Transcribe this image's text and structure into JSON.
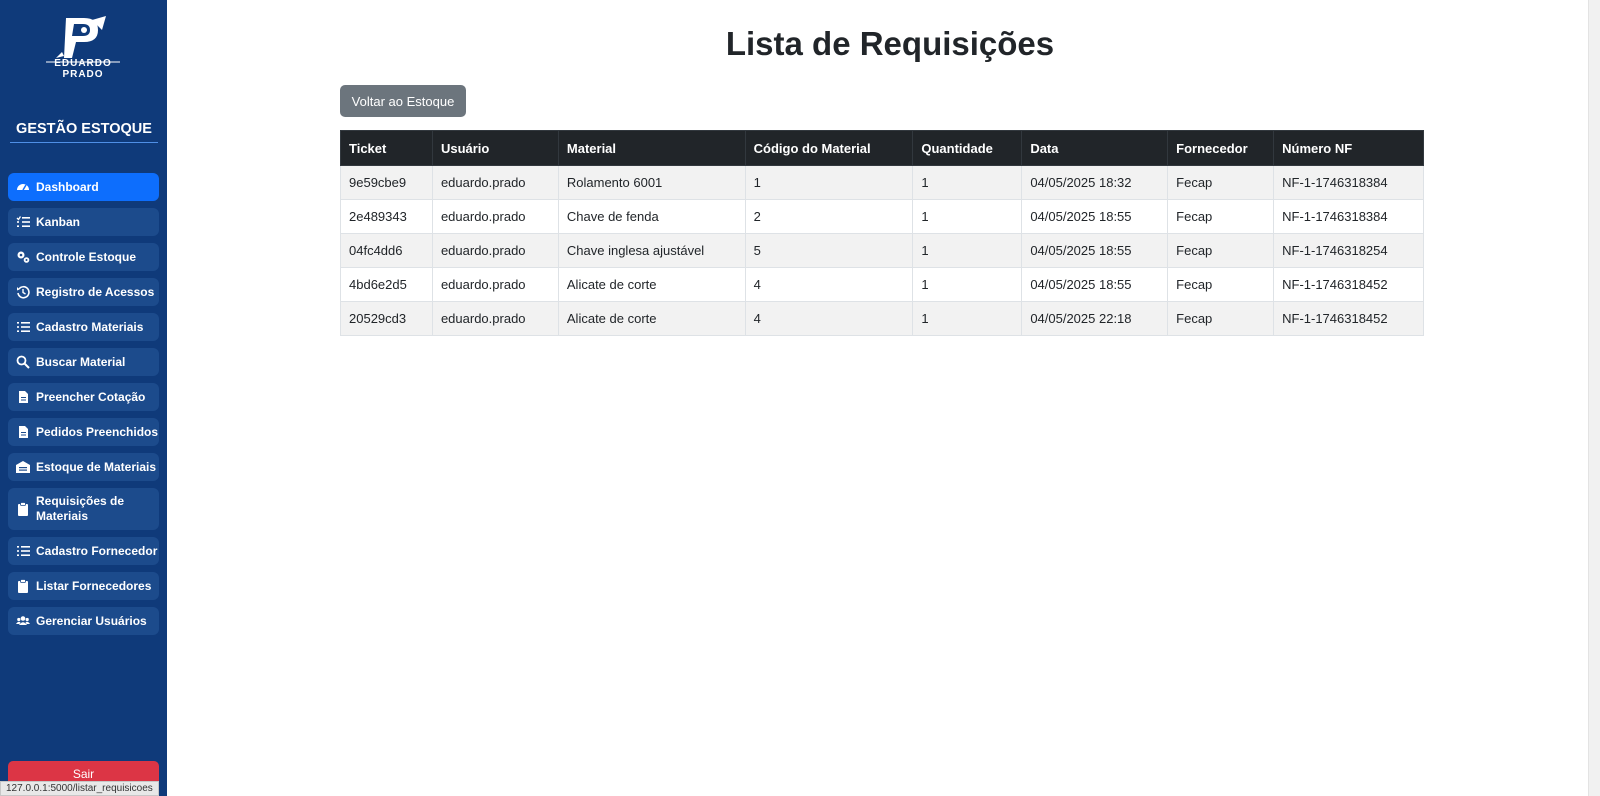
{
  "sidebar": {
    "logo_text": "EDUARDO PRADO",
    "title": "GESTÃO ESTOQUE",
    "items": [
      {
        "label": "Dashboard",
        "icon": "gauge-icon"
      },
      {
        "label": "Kanban",
        "icon": "list-check-icon"
      },
      {
        "label": "Controle Estoque",
        "icon": "gears-icon"
      },
      {
        "label": "Registro de Acessos",
        "icon": "history-icon"
      },
      {
        "label": "Cadastro Materiais",
        "icon": "list-icon"
      },
      {
        "label": "Buscar Material",
        "icon": "search-icon"
      },
      {
        "label": "Preencher Cotação",
        "icon": "file-icon"
      },
      {
        "label": "Pedidos Preenchidos",
        "icon": "file-icon"
      },
      {
        "label": "Estoque de Materiais",
        "icon": "warehouse-icon"
      },
      {
        "label": "Requisições de Materiais",
        "icon": "clipboard-icon"
      },
      {
        "label": "Cadastro Fornecedor",
        "icon": "list-icon"
      },
      {
        "label": "Listar Fornecedores",
        "icon": "clipboard-icon"
      },
      {
        "label": "Gerenciar Usuários",
        "icon": "users-icon"
      }
    ],
    "logout_label": "Sair"
  },
  "status_bar": {
    "url": "127.0.0.1:5000/listar_requisicoes"
  },
  "main": {
    "title": "Lista de Requisições",
    "back_button": "Voltar ao Estoque",
    "table": {
      "headers": [
        "Ticket",
        "Usuário",
        "Material",
        "Código do Material",
        "Quantidade",
        "Data",
        "Fornecedor",
        "Número NF"
      ],
      "rows": [
        [
          "9e59cbe9",
          "eduardo.prado",
          "Rolamento 6001",
          "1",
          "1",
          "04/05/2025 18:32",
          "Fecap",
          "NF-1-1746318384"
        ],
        [
          "2e489343",
          "eduardo.prado",
          "Chave de fenda",
          "2",
          "1",
          "04/05/2025 18:55",
          "Fecap",
          "NF-1-1746318384"
        ],
        [
          "04fc4dd6",
          "eduardo.prado",
          "Chave inglesa ajustável",
          "5",
          "1",
          "04/05/2025 18:55",
          "Fecap",
          "NF-1-1746318254"
        ],
        [
          "4bd6e2d5",
          "eduardo.prado",
          "Alicate de corte",
          "4",
          "1",
          "04/05/2025 18:55",
          "Fecap",
          "NF-1-1746318452"
        ],
        [
          "20529cd3",
          "eduardo.prado",
          "Alicate de corte",
          "4",
          "1",
          "04/05/2025 22:18",
          "Fecap",
          "NF-1-1746318452"
        ]
      ]
    }
  },
  "colors": {
    "sidebar_bg": "#0f3a7a",
    "nav_item_bg": "#1c4b8c",
    "active_item": "#0d6efd",
    "logout": "#dc3545",
    "button_secondary": "#6c757d",
    "table_header": "#212529"
  }
}
